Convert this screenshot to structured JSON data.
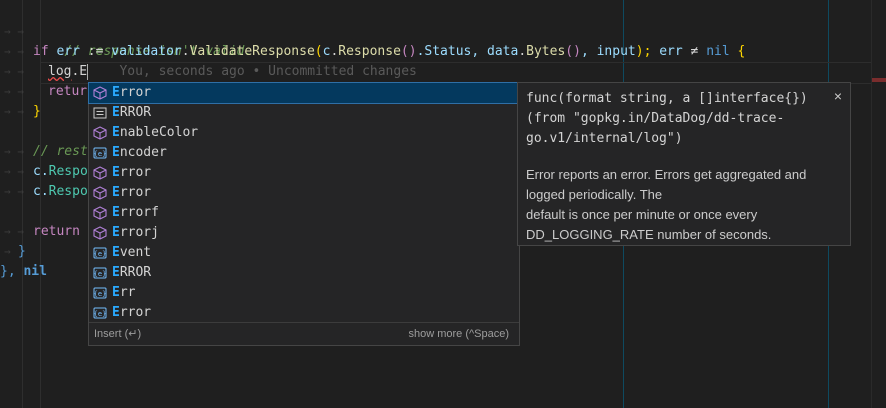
{
  "editor": {
    "lines": {
      "l1_comment": "// response isn't valid.",
      "l2_if": "if",
      "l2_err": "err",
      "l2_assign": ":=",
      "l2_validator": "validator",
      "l2_dot1": ".",
      "l2_fn": "ValidateResponse",
      "l2_open": "(",
      "l2_c": "c",
      "l2_dot2": ".",
      "l2_response": "Response",
      "l2_call": "()",
      "l2_status": ".Status, ",
      "l2_data": "data",
      "l2_bytes_dot": ".",
      "l2_bytes": "Bytes",
      "l2_bytes_call": "()",
      "l2_input": ", input",
      "l2_close": ");",
      "l2_err2": " err",
      "l2_neq": " ≠ ",
      "l2_nil": "nil",
      "l2_brace": " {",
      "l3_log": "log",
      "l3_dotE": ".E",
      "l3_blame": "You, seconds ago • Uncommitted changes",
      "l4_return": "retur",
      "l5_brace": "}",
      "l7_comment": "// rest",
      "l8_c": "c.",
      "l8_respo": "Respo",
      "l9_c": "c.",
      "l9_respo": "Respo",
      "l11_return": "return",
      "l12_brace": "}",
      "l13_close": "}, ",
      "l13_nil": "nil"
    }
  },
  "suggest": {
    "items": [
      {
        "icon": "cube-icon",
        "bold": "E",
        "rest": "rror",
        "selected": true
      },
      {
        "icon": "constant-icon",
        "bold": "E",
        "rest": "RROR"
      },
      {
        "icon": "cube-icon",
        "bold": "E",
        "rest": "nableColor"
      },
      {
        "icon": "field-icon",
        "bold": "E",
        "rest": "ncoder"
      },
      {
        "icon": "cube-icon",
        "bold": "E",
        "rest": "rror"
      },
      {
        "icon": "cube-icon",
        "bold": "E",
        "rest": "rror"
      },
      {
        "icon": "cube-icon",
        "bold": "E",
        "rest": "rrorf"
      },
      {
        "icon": "cube-icon",
        "bold": "E",
        "rest": "rrorj"
      },
      {
        "icon": "field-icon",
        "bold": "E",
        "rest": "vent"
      },
      {
        "icon": "field-icon",
        "bold": "E",
        "rest": "RROR"
      },
      {
        "icon": "field-icon",
        "bold": "E",
        "rest": "rr"
      },
      {
        "icon": "field-icon",
        "bold": "E",
        "rest": "rror"
      }
    ],
    "footer_left": "Insert (↵)",
    "footer_right": "show more (^Space)"
  },
  "details": {
    "signature": "func(format string, a []interface{}) (from \"gopkg.in/DataDog/dd-trace-go.v1/internal/log\")",
    "close_label": "×",
    "doc_lines": [
      "Error reports an error. Errors get aggregated and",
      "logged periodically. The",
      "default is once per minute or once every",
      "DD_LOGGING_RATE number of seconds."
    ]
  },
  "colors": {
    "background": "#1f1f1f",
    "widget": "#252526",
    "selection": "#04395e",
    "match_highlight": "#2aaaff"
  }
}
